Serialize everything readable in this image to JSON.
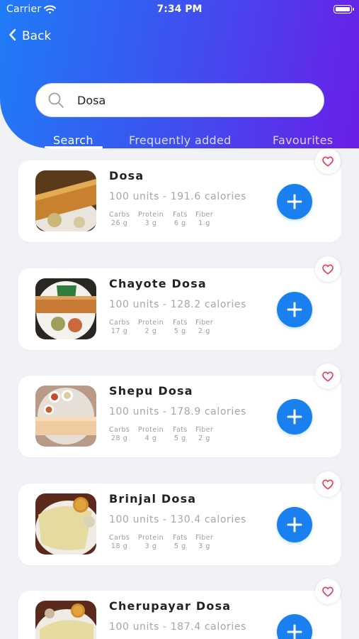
{
  "status_bar": {
    "carrier": "Carrier",
    "time": "7:34 PM"
  },
  "nav": {
    "back_label": "Back"
  },
  "search": {
    "value": "Dosa"
  },
  "tabs": [
    {
      "label": "Search",
      "active": true
    },
    {
      "label": "Frequently added",
      "active": false
    },
    {
      "label": "Favourites",
      "active": false
    }
  ],
  "nutrient_labels": {
    "carbs": "Carbs",
    "protein": "Protein",
    "fats": "Fats",
    "fiber": "Fiber"
  },
  "foods": [
    {
      "name": "Dosa",
      "info": "100 units - 191.6 calories",
      "carbs": "26 g",
      "protein": "3 g",
      "fats": "6 g",
      "fiber": "1 g"
    },
    {
      "name": "Chayote Dosa",
      "info": "100 units - 128.2 calories",
      "carbs": "17 g",
      "protein": "2 g",
      "fats": "5 g",
      "fiber": "2 g"
    },
    {
      "name": "Shepu Dosa",
      "info": "100 units - 178.9 calories",
      "carbs": "28 g",
      "protein": "4 g",
      "fats": "5 g",
      "fiber": "2 g"
    },
    {
      "name": "Brinjal Dosa",
      "info": "100 units - 130.4 calories",
      "carbs": "18 g",
      "protein": "3 g",
      "fats": "5 g",
      "fiber": "3 g"
    },
    {
      "name": "Cherupayar Dosa",
      "info": "100 units - 187.4 calories"
    }
  ],
  "colors": {
    "accent": "#1a80f0",
    "gradient_start": "#1f7cf6",
    "gradient_end": "#6a1ee8",
    "heart": "#e23a5a"
  }
}
